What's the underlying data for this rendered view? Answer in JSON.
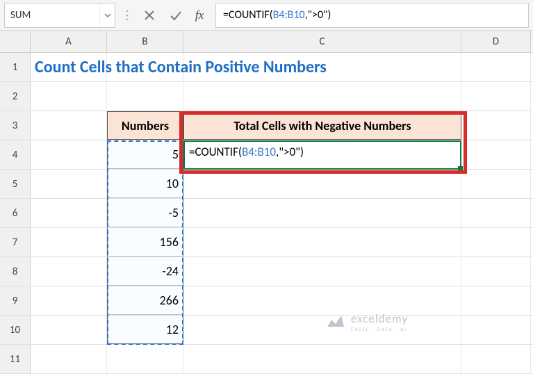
{
  "namebox": "SUM",
  "formula_prefix": "=COUNTIF(",
  "formula_ref": "B4:B10",
  "formula_suffix": ",\">0\")",
  "columns": {
    "A": "A",
    "B": "B",
    "C": "C",
    "D": "D"
  },
  "row_labels": [
    "1",
    "2",
    "3",
    "4",
    "5",
    "6",
    "7",
    "8",
    "9",
    "10",
    "11"
  ],
  "title": "Count Cells that Contain Positive Numbers",
  "headers": {
    "b": "Numbers",
    "c": "Total Cells with Negative Numbers"
  },
  "numbers": [
    "5",
    "10",
    "-5",
    "156",
    "-24",
    "266",
    "12"
  ],
  "edit_prefix": "=COUNTIF(",
  "edit_ref": "B4:B10",
  "edit_suffix": ",\">0\")",
  "watermark": {
    "name": "exceldemy",
    "sub": "EXCEL · DATA · BI"
  }
}
